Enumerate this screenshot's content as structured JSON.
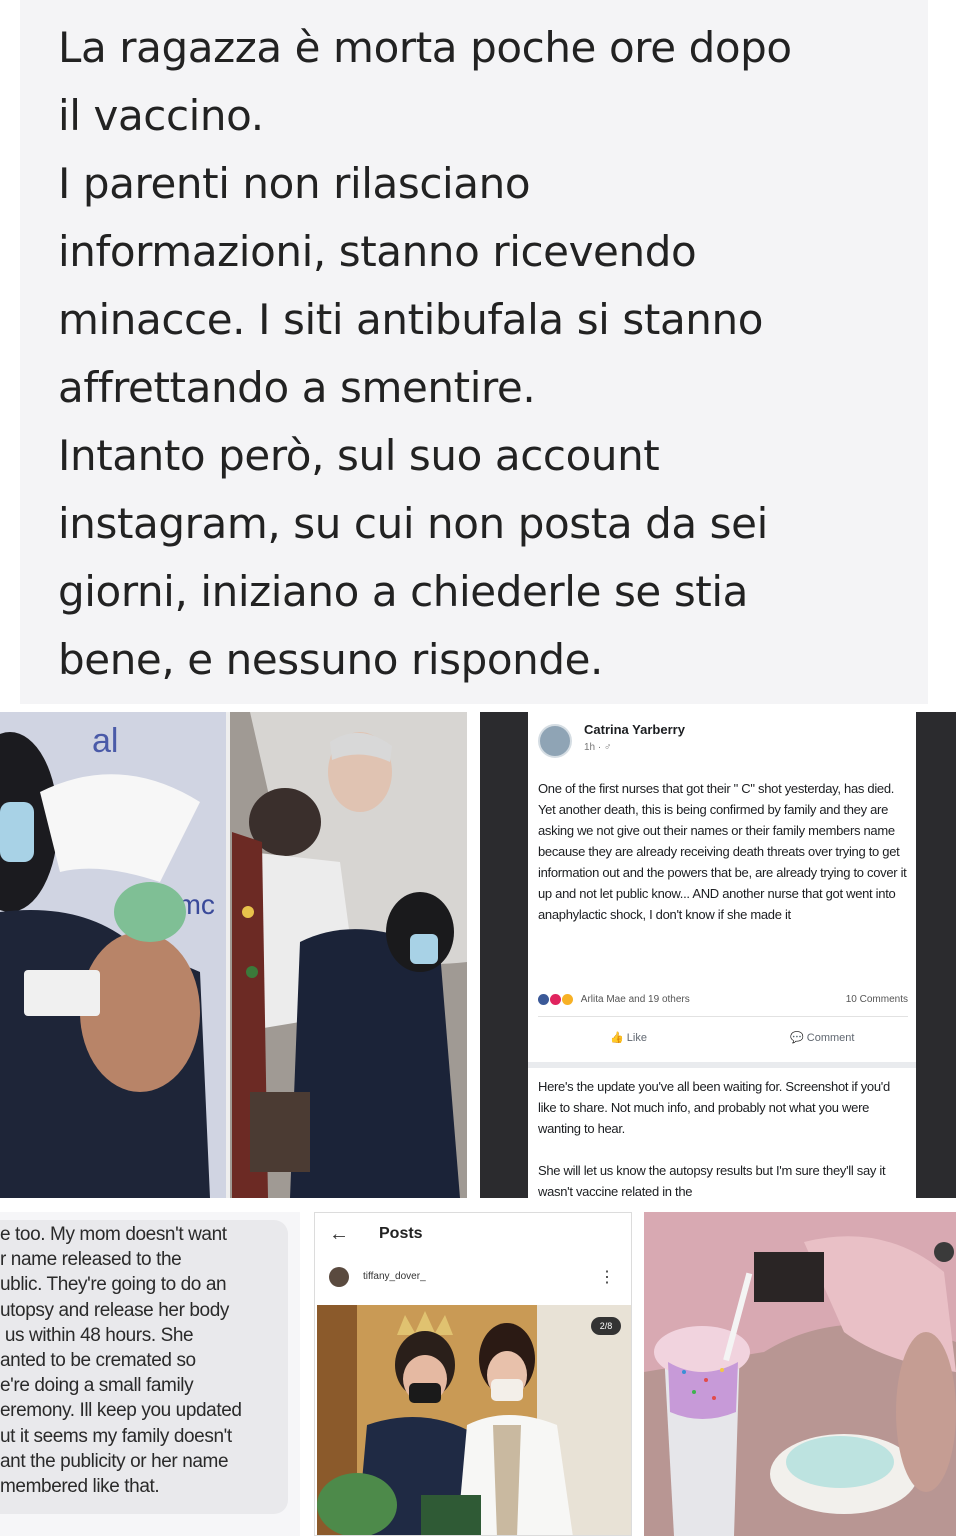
{
  "post": {
    "lines": [
      "La ragazza è morta poche ore dopo",
      "il vaccino.",
      "I parenti non rilasciano",
      "informazioni, stanno ricevendo",
      "minacce. I siti antibufala si stanno",
      "affrettando a smentire.",
      "Intanto però, sul suo account",
      "instagram, su cui non posta da sei",
      "giorni, iniziano a chiederle se stia",
      "bene, e nessuno risponde."
    ]
  },
  "photo": {
    "sign_left": "al",
    "sign_right": "emc"
  },
  "fb": {
    "name": "Catrina Yarberry",
    "meta": "1h · ♂",
    "body": "One of the first nurses that got their \" C\" shot yesterday, has died.  Yet another death,  this is being confirmed by family and they are asking we not give out their names or their family members name because they are already receiving death threats over trying to get information out and the powers that be, are already trying to cover it up and not let public know... AND another nurse that got went into anaphylactic shock,  I don't know if she made it",
    "reactions_who": "Arlita Mae and 19 others",
    "comments_count": "10 Comments",
    "like_label": "Like",
    "comment_label": "Comment",
    "update": "Here's the update you've all been waiting for. Screenshot if you'd like to share. Not much info, and probably not what you were wanting to hear.",
    "update2": "She will let us know the autopsy results but I'm sure they'll say it wasn't vaccine related in the",
    "colors": {
      "like": "#3b5998",
      "love": "#e0245e",
      "haha": "#f7b125"
    }
  },
  "message": {
    "text": "e too. My mom doesn't want\nr name released to the\nublic. They're going to do an\nutopsy and release her body\n us within 48 hours. She\nanted to be cremated so\ne're doing a small family\neremony. Ill keep you updated\nut it seems my family doesn't\nant the publicity or her name\nmembered like that."
  },
  "instagram": {
    "back": "←",
    "title": "Posts",
    "username": "tiffany_dover_",
    "more": "⋮",
    "badge": "2/8"
  }
}
